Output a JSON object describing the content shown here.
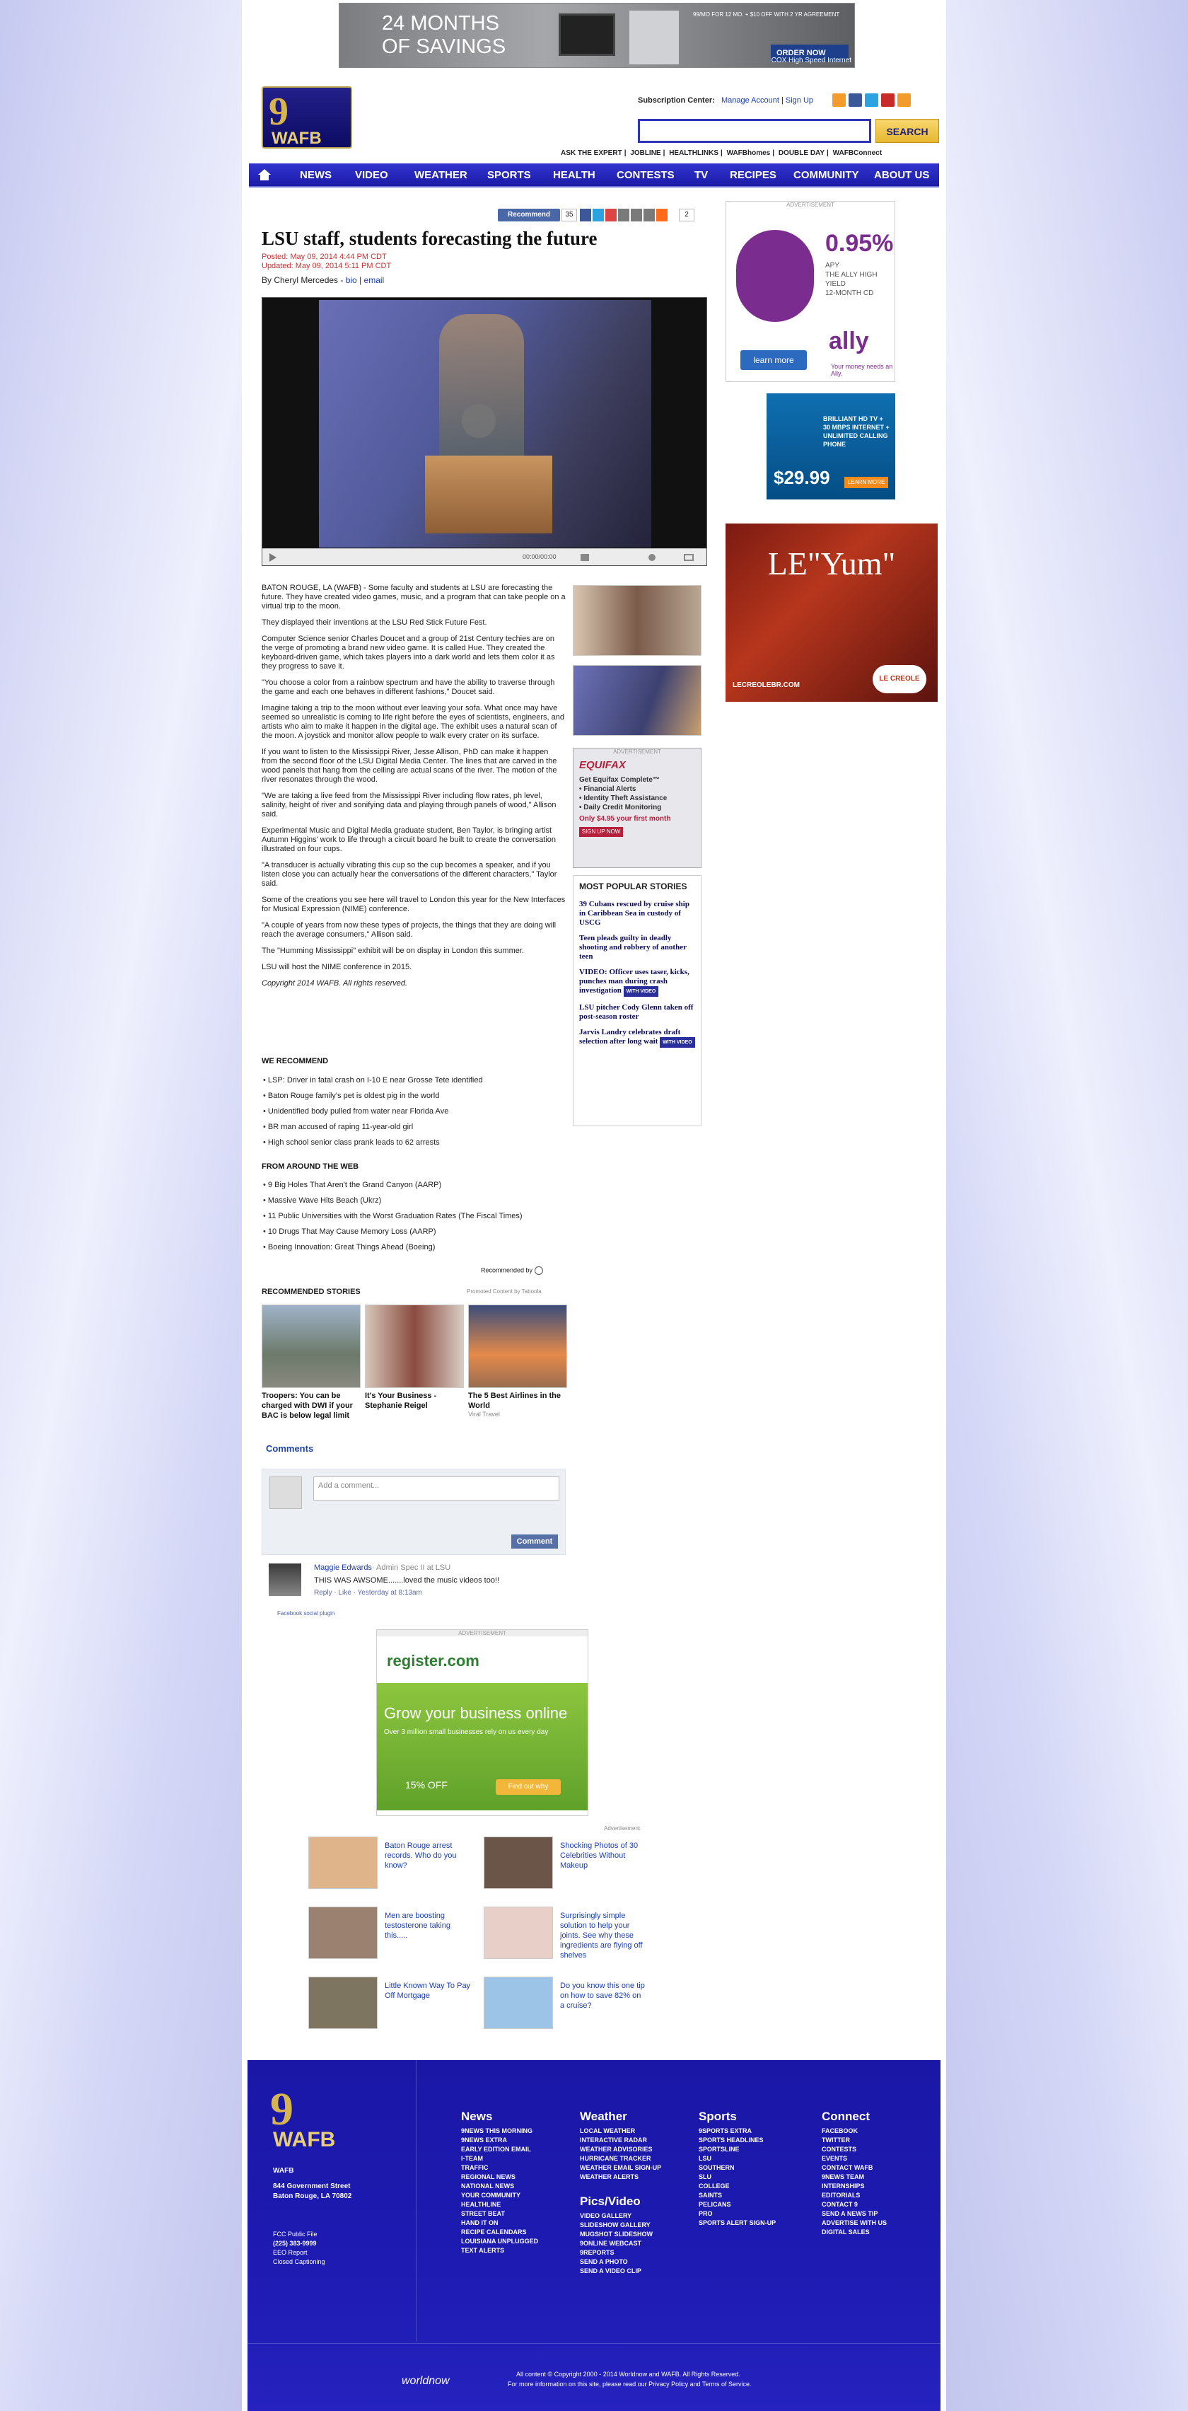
{
  "top_ad": {
    "headline": "24 MONTHS\nOF SAVINGS",
    "desc": "99/MO FOR 12 MO. + $10 OFF WITH 2 YR AGREEMENT",
    "order": "ORDER NOW",
    "brand": "COX High Speed Internet"
  },
  "header": {
    "logo_number": "9",
    "logo_text": "WAFB",
    "subscription_label": "Subscription Center:",
    "manage_account": "Manage Account",
    "sign_up": "Sign Up",
    "search_button": "SEARCH",
    "top_links": [
      "ASK THE EXPERT",
      "JOBLINE",
      "HEALTHLINKS",
      "WAFBhomes",
      "DOUBLE DAY",
      "WAFBConnect"
    ]
  },
  "nav": {
    "items": [
      "NEWS",
      "VIDEO",
      "WEATHER",
      "SPORTS",
      "HEALTH",
      "CONTESTS",
      "TV",
      "RECIPES",
      "COMMUNITY",
      "ABOUT US"
    ]
  },
  "share": {
    "recommend": "Recommend",
    "recommend_count": "35",
    "share_count": "2"
  },
  "article": {
    "title": "LSU staff, students forecasting the future",
    "posted": "Posted: May 09, 2014 4:44 PM CDT",
    "updated": "Updated: May 09, 2014 5:11 PM CDT",
    "byline_prefix": "By Cheryl Mercedes",
    "bio": "bio",
    "email": "email",
    "video_time": "00:00/00:00",
    "paragraphs": [
      "BATON ROUGE, LA (WAFB) - Some faculty and students at LSU are forecasting the future. They have created video games, music, and a program that can take people on a virtual trip to the moon.",
      "They displayed their inventions at the LSU Red Stick Future Fest.",
      "Computer Science senior Charles Doucet and a group of 21st Century techies are on the verge of promoting a brand new video game. It is called Hue. They created the keyboard-driven game, which takes players into a dark world and lets them color it as they progress to save it.",
      "\"You choose a color from a rainbow spectrum and have the ability to traverse through the game and each one behaves in different fashions,\" Doucet said.",
      "Imagine taking a trip to the moon without ever leaving your sofa. What once may have seemed so unrealistic is coming to life right before the eyes of scientists, engineers, and artists who aim to make it happen in the digital age. The exhibit uses a natural scan of the moon. A joystick and monitor allow people to walk every crater on its surface.",
      "If you want to listen to the Mississippi River, Jesse Allison, PhD can make it happen from the second floor of the LSU Digital Media Center. The lines that are carved in the wood panels that hang from the ceiling are actual scans of the river. The motion of the river resonates through the wood.",
      "\"We are taking a live feed from the Mississippi River including flow rates, ph level, salinity, height of river and sonifying data and playing through panels of wood,\" Allison said.",
      "Experimental Music and Digital Media graduate student, Ben Taylor, is bringing artist Autumn Higgins' work to life through a circuit board he built to create the conversation illustrated on four cups.",
      "\"A transducer is actually vibrating this cup so the cup becomes a speaker, and if you listen close you can actually hear the conversations of the different characters,\" Taylor said.",
      "Some of the creations you see here will travel to London this year for the New Interfaces for Musical Expression (NIME) conference.",
      "\"A couple of years from now these types of projects, the things that they are doing will reach the average consumers,\" Allison said.",
      "The \"Humming Mississippi\" exhibit will be on display in London this summer.",
      "LSU will host the NIME conference in 2015."
    ],
    "copyright": "Copyright 2014 WAFB. All rights reserved."
  },
  "we_recommend": {
    "title": "WE RECOMMEND",
    "items": [
      "LSP: Driver in fatal crash on I-10 E near Grosse Tete identified",
      "Baton Rouge family's pet is oldest pig in the world",
      "Unidentified body pulled from water near Florida Ave",
      "BR man accused of raping 11-year-old girl",
      "High school senior class prank leads to 62 arrests"
    ]
  },
  "around_web": {
    "title": "FROM AROUND THE WEB",
    "items": [
      "9 Big Holes That Aren't the Grand Canyon (AARP)",
      "Massive Wave Hits Beach (Ukrz)",
      "11 Public Universities with the Worst Graduation Rates (The Fiscal Times)",
      "10 Drugs That May Cause Memory Loss (AARP)",
      "Boeing Innovation: Great Things Ahead (Boeing)"
    ],
    "recommended_by": "Recommended by"
  },
  "recommended_stories": {
    "title": "RECOMMENDED STORIES",
    "promoted": "Promoted Content by Taboola",
    "cards": [
      {
        "caption": "Troopers: You can be charged with DWI if your BAC is below legal limit",
        "source": ""
      },
      {
        "caption": "It's Your Business - Stephanie Reigel",
        "source": ""
      },
      {
        "caption": "The 5 Best Airlines in the World",
        "source": "Viral Travel"
      }
    ]
  },
  "comments": {
    "title": "Comments",
    "placeholder": "Add a comment...",
    "button": "Comment",
    "author": "Maggie Edwards",
    "author_meta": "· Admin Spec II at LSU",
    "text": "THIS WAS AWSOME.......loved the music videos too!!",
    "meta": "Reply · Like · Yesterday at 8:13am",
    "plugin": "Facebook social plugin"
  },
  "sidebar": {
    "advertisement": "ADVERTISEMENT",
    "ally": {
      "rate": "0.95%",
      "apy": "APY\nTHE ALLY HIGH YIELD\n12-MONTH CD",
      "learn": "learn more",
      "brand": "ally",
      "tag": "Your money needs an Ally."
    },
    "charter": {
      "text": "BRILLIANT HD TV +\n30 MBPS INTERNET +\nUNLIMITED CALLING\nPHONE",
      "price": "$29.99",
      "learn": "LEARN MORE"
    },
    "leyum": {
      "title": "LE\"Yum\"",
      "url": "LECREOLEBR.COM",
      "brand": "LE CREOLE"
    },
    "equifax": {
      "logo": "EQUIFAX",
      "text": "Get Equifax Complete™\n• Financial Alerts\n• Identity Theft Assistance\n• Daily Credit Monitoring",
      "price": "Only $4.95 your first month",
      "btn": "SIGN UP NOW"
    },
    "popular": {
      "title": "MOST POPULAR STORIES",
      "items": [
        "39 Cubans rescued by cruise ship in Caribbean Sea in custody of USCG",
        "Teen pleads guilty in deadly shooting and robbery of another teen",
        "VIDEO: Officer uses taser, kicks, punches man during crash investigation",
        "LSU pitcher Cody Glenn taken off post-season roster",
        "Jarvis Landry celebrates draft selection after long wait"
      ],
      "with_video": "WITH VIDEO"
    }
  },
  "register_ad": {
    "logo": "register.com",
    "headline": "Grow your business online",
    "sub": "Over 3 million small businesses rely on us every day",
    "off": "15% OFF",
    "find": "Find out why"
  },
  "advertisement_label": "Advertisement",
  "promos": [
    {
      "text": "Baton Rouge arrest records. Who do you know?"
    },
    {
      "text": "Shocking Photos of 30 Celebrities Without Makeup"
    },
    {
      "text": "Men are boosting testosterone taking this....."
    },
    {
      "text": "Surprisingly simple solution to help your joints. See why these ingredients are flying off shelves"
    },
    {
      "text": "Little Known Way To Pay Off Mortgage"
    },
    {
      "text": "Do you know this one tip on how to save 82% on a cruise?"
    }
  ],
  "footer": {
    "logo_number": "9",
    "logo_text": "WAFB",
    "station": "WAFB",
    "street": "844 Government Street",
    "city": "Baton Rouge, LA 70802",
    "links": [
      "FCC Public File",
      "(225) 383-9999",
      "EEO Report",
      "Closed Captioning"
    ],
    "columns": [
      {
        "title": "News",
        "items": [
          "9NEWS THIS MORNING",
          "9NEWS EXTRA",
          "EARLY EDITION EMAIL",
          "I-TEAM",
          "TRAFFIC",
          "REGIONAL NEWS",
          "NATIONAL NEWS",
          "YOUR COMMUNITY",
          "HEALTHLINE",
          "STREET BEAT",
          "HAND IT ON",
          "RECIPE CALENDARS",
          "LOUISIANA UNPLUGGED",
          "TEXT ALERTS"
        ]
      },
      {
        "title": "Weather",
        "items": [
          "LOCAL WEATHER",
          "INTERACTIVE RADAR",
          "WEATHER ADVISORIES",
          "HURRICANE TRACKER",
          "WEATHER EMAIL SIGN-UP",
          "WEATHER ALERTS"
        ]
      },
      {
        "title": "Pics/Video",
        "items": [
          "VIDEO GALLERY",
          "SLIDESHOW GALLERY",
          "MUGSHOT SLIDESHOW",
          "9ONLINE WEBCAST",
          "9REPORTS",
          "SEND A PHOTO",
          "SEND A VIDEO CLIP"
        ]
      },
      {
        "title": "Sports",
        "items": [
          "9SPORTS EXTRA",
          "SPORTS HEADLINES",
          "SPORTSLINE",
          "LSU",
          "SOUTHERN",
          "SLU",
          "COLLEGE",
          "SAINTS",
          "PELICANS",
          "PRO",
          "SPORTS ALERT SIGN-UP"
        ]
      },
      {
        "title": "Connect",
        "items": [
          "FACEBOOK",
          "TWITTER",
          "CONTESTS",
          "EVENTS",
          "CONTACT WAFB",
          "9NEWS TEAM",
          "INTERNSHIPS",
          "EDITORIALS",
          "CONTACT 9",
          "SEND A NEWS TIP",
          "ADVERTISE WITH US",
          "DIGITAL SALES"
        ]
      }
    ],
    "worldnow": "worldnow",
    "copyright": "All content © Copyright 2000 - 2014 Worldnow and WAFB. All Rights Reserved.",
    "privacy": "For more information on this site, please read our Privacy Policy and Terms of Service."
  },
  "colors": {
    "nav": "#2224b8",
    "link": "#1a3db4",
    "footer": "#1d1bb2",
    "gold": "#d6b44f"
  }
}
